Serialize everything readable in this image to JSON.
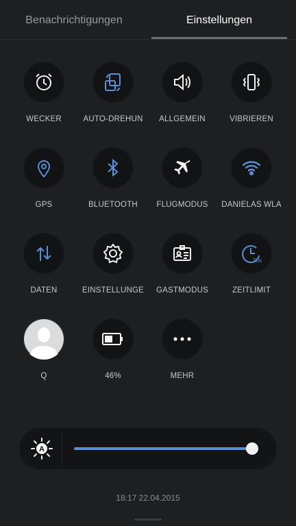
{
  "tabs": {
    "notifications": "Benachrichtigungen",
    "settings": "Einstellungen",
    "active": "settings"
  },
  "tiles": [
    {
      "id": "wecker",
      "label": "WECKER",
      "icon": "alarm-clock-icon",
      "active": false
    },
    {
      "id": "autorotate",
      "label": "AUTO-DREHUN",
      "icon": "auto-rotate-icon",
      "active": true
    },
    {
      "id": "sound",
      "label": "ALLGEMEIN",
      "icon": "speaker-icon",
      "active": false
    },
    {
      "id": "vibrate",
      "label": "VIBRIEREN",
      "icon": "vibrate-icon",
      "active": false
    },
    {
      "id": "gps",
      "label": "GPS",
      "icon": "location-pin-icon",
      "active": true
    },
    {
      "id": "bluetooth",
      "label": "BLUETOOTH",
      "icon": "bluetooth-icon",
      "active": true
    },
    {
      "id": "flightmode",
      "label": "FLUGMODUS",
      "icon": "airplane-icon",
      "active": false
    },
    {
      "id": "wifi",
      "label": "DANIELAS WLA",
      "icon": "wifi-icon",
      "active": true
    },
    {
      "id": "data",
      "label": "DATEN",
      "icon": "data-arrows-icon",
      "active": true
    },
    {
      "id": "settings",
      "label": "EINSTELLUNGE",
      "icon": "gear-icon",
      "active": false
    },
    {
      "id": "guest",
      "label": "GASTMODUS",
      "icon": "id-card-icon",
      "active": false
    },
    {
      "id": "timeout",
      "label": "ZEITLIMIT",
      "icon": "timer-icon",
      "active": true,
      "badge": "30s"
    },
    {
      "id": "user",
      "label": "Q",
      "icon": "user-avatar-icon",
      "active": false
    },
    {
      "id": "battery",
      "label": "46%",
      "icon": "battery-icon",
      "active": false,
      "level": 0.46
    },
    {
      "id": "more",
      "label": "MEHR",
      "icon": "more-dots-icon",
      "active": false
    }
  ],
  "brightness": {
    "level": 0.97,
    "auto_icon": "auto-brightness-icon",
    "auto_letter": "A"
  },
  "datetime": "18:17  22.04.2015",
  "colors": {
    "accent": "#5b8fd6",
    "icon_white": "#f2f2f2",
    "background": "#1d1f21"
  }
}
